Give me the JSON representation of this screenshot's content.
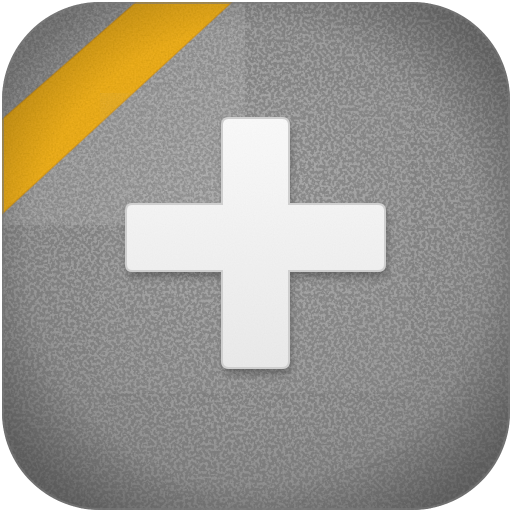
{
  "icon": {
    "name": "add-plus-icon",
    "symbol": "plus",
    "colors": {
      "concrete": "#9a9a9a",
      "concrete_light": "#b6b6b6",
      "concrete_dark": "#7e7e7e",
      "stripe": "#f2b21b",
      "stripe_dark": "#d9960d",
      "plus": "#f2f2f2",
      "plus_shadow": "#cfcfcf"
    }
  }
}
